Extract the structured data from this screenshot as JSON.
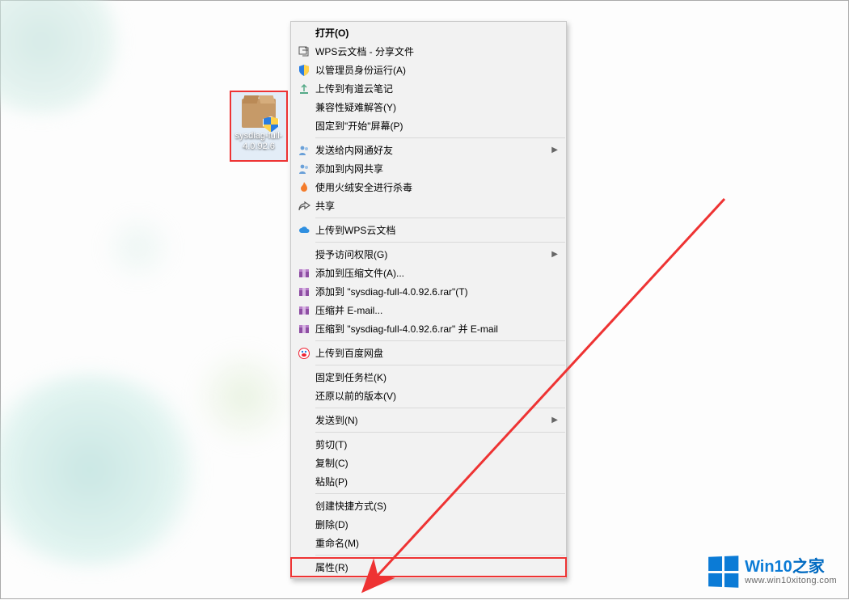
{
  "desktop_icon": {
    "label_line1": "sysdiag-full-",
    "label_line2": "4.0.92.6"
  },
  "menu": {
    "items": [
      {
        "id": "open",
        "label": "打开(O)",
        "bold": true,
        "sep_after": false,
        "icon": ""
      },
      {
        "id": "wps-share",
        "label": "WPS云文档 - 分享文件",
        "icon": "share-icon"
      },
      {
        "id": "run-admin",
        "label": "以管理员身份运行(A)",
        "icon": "shield-icon"
      },
      {
        "id": "upload-youdao",
        "label": "上传到有道云笔记",
        "icon": "upload-icon"
      },
      {
        "id": "compat",
        "label": "兼容性疑难解答(Y)",
        "icon": ""
      },
      {
        "id": "pin-start",
        "label": "固定到\"开始\"屏幕(P)",
        "icon": "",
        "sep_after": true
      },
      {
        "id": "send-intranet",
        "label": "发送给内网通好友",
        "icon": "people-icon",
        "submenu": true
      },
      {
        "id": "add-intranet",
        "label": "添加到内网共享",
        "icon": "people-icon"
      },
      {
        "id": "huorong",
        "label": "使用火绒安全进行杀毒",
        "icon": "flame-icon"
      },
      {
        "id": "share",
        "label": "共享",
        "icon": "share-arrow-icon",
        "sep_after": true
      },
      {
        "id": "upload-wps",
        "label": "上传到WPS云文档",
        "icon": "cloud-icon",
        "sep_after": true
      },
      {
        "id": "grant-access",
        "label": "授予访问权限(G)",
        "icon": "",
        "submenu": true
      },
      {
        "id": "add-archive",
        "label": "添加到压缩文件(A)...",
        "icon": "archive-icon"
      },
      {
        "id": "add-archive-named",
        "label": "添加到 \"sysdiag-full-4.0.92.6.rar\"(T)",
        "icon": "archive-icon"
      },
      {
        "id": "compress-email",
        "label": "压缩并 E-mail...",
        "icon": "archive-icon"
      },
      {
        "id": "compress-named-email",
        "label": "压缩到 \"sysdiag-full-4.0.92.6.rar\" 并 E-mail",
        "icon": "archive-icon",
        "sep_after": true
      },
      {
        "id": "upload-baidu",
        "label": "上传到百度网盘",
        "icon": "baidu-icon",
        "sep_after": true
      },
      {
        "id": "pin-taskbar",
        "label": "固定到任务栏(K)",
        "icon": ""
      },
      {
        "id": "restore-prev",
        "label": "还原以前的版本(V)",
        "icon": "",
        "sep_after": true
      },
      {
        "id": "send-to",
        "label": "发送到(N)",
        "icon": "",
        "submenu": true,
        "sep_after": true
      },
      {
        "id": "cut",
        "label": "剪切(T)",
        "icon": ""
      },
      {
        "id": "copy",
        "label": "复制(C)",
        "icon": ""
      },
      {
        "id": "paste",
        "label": "粘贴(P)",
        "icon": "",
        "sep_after": true
      },
      {
        "id": "create-shortcut",
        "label": "创建快捷方式(S)",
        "icon": ""
      },
      {
        "id": "delete",
        "label": "删除(D)",
        "icon": ""
      },
      {
        "id": "rename",
        "label": "重命名(M)",
        "icon": "",
        "sep_after": true
      },
      {
        "id": "properties",
        "label": "属性(R)",
        "icon": "",
        "highlight": true
      }
    ]
  },
  "watermark": {
    "brand_main": "Win10",
    "brand_suffix": "之家",
    "url": "www.win10xitong.com"
  }
}
